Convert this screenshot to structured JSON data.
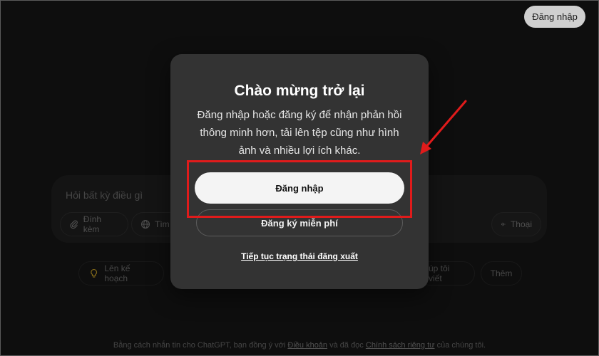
{
  "header": {
    "login_label": "Đăng nhập"
  },
  "composer": {
    "placeholder": "Hỏi bất kỳ điều gì",
    "attach_label": "Đính kèm",
    "search_label": "Tìm k",
    "voice_label": "Thoại"
  },
  "suggestions": {
    "plan_label": "Lên kế hoạch",
    "write_label": "úp tôi viết",
    "more_label": "Thêm"
  },
  "footer": {
    "prefix": "Bằng cách nhắn tin cho ChatGPT, bạn đồng ý với ",
    "terms_link": "Điều khoản",
    "middle": " và đã đọc ",
    "privacy_link": "Chính sách riêng tư",
    "suffix": " của chúng tôi."
  },
  "modal": {
    "title": "Chào mừng trở lại",
    "description": "Đăng nhập hoặc đăng ký để nhận phản hồi thông minh hơn, tải lên tệp cũng như hình ảnh và nhiều lợi ích khác.",
    "login_button": "Đăng nhập",
    "signup_button": "Đăng ký miễn phí",
    "logout_link": "Tiếp tục trạng thái đăng xuất"
  },
  "colors": {
    "annotation_red": "#e01b1b",
    "modal_bg": "#333333",
    "page_bg": "#161616"
  },
  "icons": [
    "paperclip-icon",
    "globe-icon",
    "voice-wave-icon",
    "lightbulb-icon",
    "annotation-arrow"
  ]
}
